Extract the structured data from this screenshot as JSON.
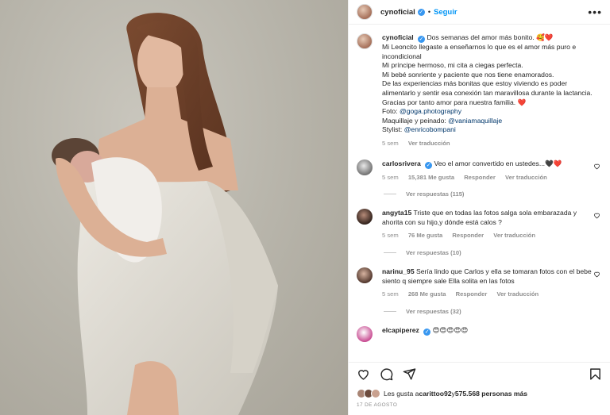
{
  "header": {
    "username": "cynoficial",
    "separator": "•",
    "follow_label": "Seguir",
    "more_label": "•••"
  },
  "caption": {
    "username": "cynoficial",
    "lines": [
      "Dos semanas del amor más bonito. 🥰❤️",
      "Mi Leoncito llegaste a enseñarnos lo que es el amor más puro e incondicional",
      "Mi príncipe hermoso, mi cita a ciegas perfecta.",
      "Mi bebé sonriente y paciente que nos tiene enamorados.",
      "De las experiencias más bonitas que estoy viviendo es poder alimentarlo y sentir esa conexión tan maravillosa durante la lactancia.",
      "Gracias por tanto amor para nuestra familia. ❤️"
    ],
    "credits": [
      {
        "label": "Foto: ",
        "handle": "@goga.photography"
      },
      {
        "label": "Maquillaje y peinado: ",
        "handle": "@vaniamaquillaje"
      },
      {
        "label": "Stylist: ",
        "handle": "@enricobompani"
      }
    ],
    "time": "5 sem",
    "translate": "Ver traducción"
  },
  "comments": [
    {
      "username": "carlosrivera",
      "verified": true,
      "text": "Veo el amor convertido en ustedes...🖤❤️",
      "time": "5 sem",
      "likes": "15,381 Me gusta",
      "reply": "Responder",
      "translate": "Ver traducción",
      "view_replies": "Ver respuestas (115)"
    },
    {
      "username": "angyta15",
      "verified": false,
      "text": "Triste que en todas las fotos salga sola embarazada y ahorita con su hijo,y dónde está calos ?",
      "time": "5 sem",
      "likes": "76 Me gusta",
      "reply": "Responder",
      "translate": "Ver traducción",
      "view_replies": "Ver respuestas (10)"
    },
    {
      "username": "narinu_95",
      "verified": false,
      "text": "Sería lindo que Carlos y ella se tomaran fotos con el bebe siento q siempre sale Ella solita en las fotos",
      "time": "5 sem",
      "likes": "268 Me gusta",
      "reply": "Responder",
      "translate": "Ver traducción",
      "view_replies": "Ver respuestas (32)"
    },
    {
      "username": "elcapiperez",
      "verified": true,
      "text": "😍😍😍😍😍",
      "time": "",
      "likes": "",
      "reply": "",
      "translate": "",
      "view_replies": ""
    }
  ],
  "likes": {
    "prefix": "Les gusta a ",
    "user": "carittoo92",
    "middle": " y ",
    "count": "575.568 personas más"
  },
  "date": "17 DE AGOSTO",
  "colors": {
    "link": "#00376b",
    "follow": "#0095f6",
    "verified": "#3897f0",
    "heart": "#ed4956"
  },
  "icons": [
    "heart-icon",
    "comment-icon",
    "share-icon",
    "bookmark-icon",
    "verified-icon",
    "more-icon"
  ]
}
